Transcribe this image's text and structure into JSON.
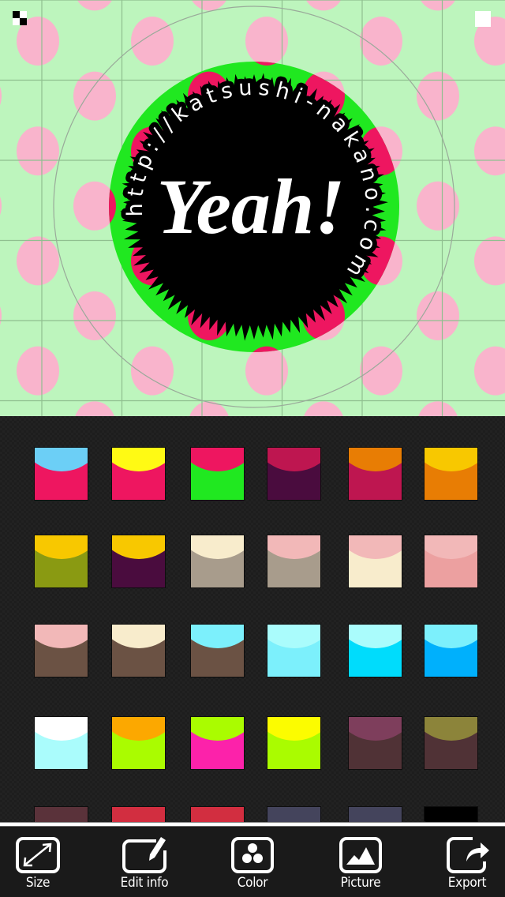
{
  "canvas": {
    "background_color": "#bdf5bd",
    "polka_dot_color": "#f9b4cc",
    "grid_line_color": "#8fbf8f",
    "guide_circle_color": "#9aaa9a",
    "badge": {
      "rim_color": "#20e820",
      "rim_dot_color": "#ee1660",
      "center_color": "#000000",
      "title": "Yeah!",
      "title_color": "#ffffff",
      "circular_text": "http://katsushi-nakano.com",
      "circular_text_color": "#ffffff"
    },
    "handles": {
      "top_left": "checker-handle-icon",
      "top_right": "square-handle-icon"
    }
  },
  "palette": {
    "selected_index": null,
    "swatches": [
      {
        "base": "#ee1660",
        "accent": "#6ccff6"
      },
      {
        "base": "#ee1660",
        "accent": "#fffa14"
      },
      {
        "base": "#20e820",
        "accent": "#ee1660"
      },
      {
        "base": "#4a0c3e",
        "accent": "#be1650"
      },
      {
        "base": "#be1650",
        "accent": "#e87d04"
      },
      {
        "base": "#e87d04",
        "accent": "#f8c800"
      },
      {
        "base": "#8a9a12",
        "accent": "#f8c800"
      },
      {
        "base": "#4a0c3e",
        "accent": "#f8c800"
      },
      {
        "base": "#a89c8c",
        "accent": "#f8eccc"
      },
      {
        "base": "#a89c8c",
        "accent": "#f2b8b8"
      },
      {
        "base": "#f8eccc",
        "accent": "#f2b8b8"
      },
      {
        "base": "#eca0a0",
        "accent": "#f2b8b8"
      },
      {
        "base": "#6b5244",
        "accent": "#f2b8b8"
      },
      {
        "base": "#6b5244",
        "accent": "#f8eccc"
      },
      {
        "base": "#6b5244",
        "accent": "#7cf0fc"
      },
      {
        "base": "#7cf0fc",
        "accent": "#aafcfc"
      },
      {
        "base": "#00dcfc",
        "accent": "#aafcfc"
      },
      {
        "base": "#00b0fc",
        "accent": "#7cf0fc"
      },
      {
        "base": "#aafcfc",
        "accent": "#ffffff"
      },
      {
        "base": "#aafc00",
        "accent": "#fca800"
      },
      {
        "base": "#fc22aa",
        "accent": "#aafc00"
      },
      {
        "base": "#aafc00",
        "accent": "#fcfc00"
      },
      {
        "base": "#503236",
        "accent": "#7e3e5c"
      },
      {
        "base": "#503236",
        "accent": "#8c843a"
      },
      {
        "base": "#d4c4a4",
        "accent": "#5a323a"
      },
      {
        "base": "#d4c4a4",
        "accent": "#d22e40"
      },
      {
        "base": "#629088",
        "accent": "#d22e40"
      },
      {
        "base": "#629088",
        "accent": "#44445c"
      },
      {
        "base": "#d22e40",
        "accent": "#44445c"
      },
      {
        "base": "#ffffff",
        "accent": "#000000"
      }
    ]
  },
  "toolbar": {
    "items": [
      {
        "id": "size",
        "label": "Size",
        "icon": "resize-icon"
      },
      {
        "id": "edit-info",
        "label": "Edit info",
        "icon": "edit-pencil-icon"
      },
      {
        "id": "color",
        "label": "Color",
        "icon": "color-dots-icon"
      },
      {
        "id": "picture",
        "label": "Picture",
        "icon": "picture-mountains-icon"
      },
      {
        "id": "export",
        "label": "Export",
        "icon": "export-share-icon"
      }
    ]
  }
}
